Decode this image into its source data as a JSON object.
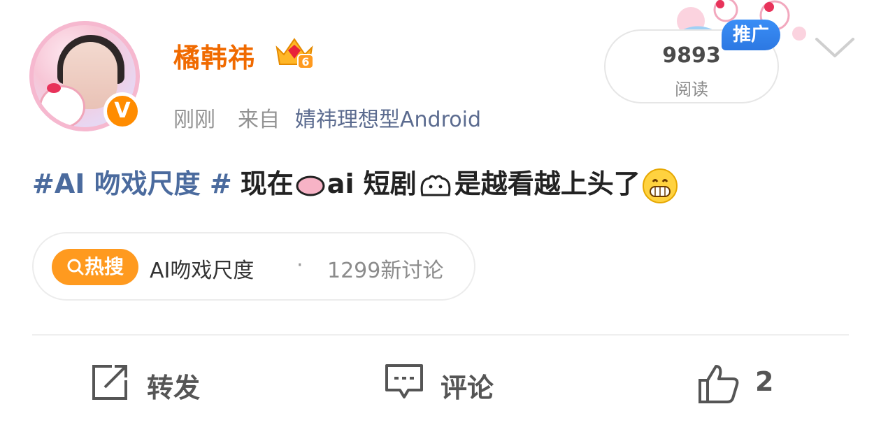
{
  "user": {
    "name": "橘韩祎",
    "level_badge": "6",
    "verified_mark": "V",
    "time": "刚刚",
    "from_label": "来自",
    "source": "婧祎理想型Android"
  },
  "views": {
    "count": "9893",
    "label": "阅读"
  },
  "promo_label": "推广",
  "post": {
    "hashtag": "#AI 吻戏尺度 #",
    "text_a": "现在",
    "text_b": "ai 短剧",
    "text_c": "是越看越上头了"
  },
  "hot_search": {
    "badge_label": "热搜",
    "topic": "AI吻戏尺度",
    "separator": "·",
    "discussion": "1299新讨论"
  },
  "actions": {
    "repost_label": "转发",
    "comment_label": "评论",
    "like_count": "2"
  },
  "colors": {
    "accent_orange": "#f06a00",
    "link_blue": "#4b6b9e",
    "promo_blue": "#2c78e2",
    "hot_orange": "#ff9a1f"
  }
}
